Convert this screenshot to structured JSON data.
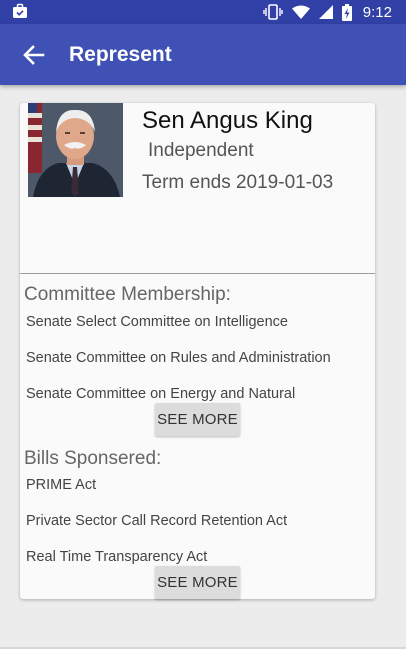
{
  "status_bar": {
    "time": "9:12",
    "icons": [
      "briefcase-icon",
      "vibrate-icon",
      "wifi-icon",
      "signal-icon",
      "battery-charging-icon"
    ]
  },
  "app_bar": {
    "title": "Represent",
    "back_icon": "arrow-back-icon"
  },
  "representative": {
    "name": "Sen Angus King",
    "party": "Independent",
    "term": "Term ends 2019-01-03"
  },
  "committees": {
    "title": "Committee Membership:",
    "items": [
      "Senate Select Committee on Intelligence",
      "Senate Committee on Rules and Administration",
      "Senate Committee on Energy and Natural"
    ],
    "button_label": "SEE MORE"
  },
  "bills": {
    "title": "Bills Sponsered:",
    "items": [
      "PRIME Act",
      "Private Sector Call Record Retention Act",
      "Real Time Transparency Act"
    ],
    "button_label": "SEE MORE"
  },
  "colors": {
    "status_bar": "#3140a6",
    "app_bar": "#3f51b5",
    "card": "#fafafa",
    "background": "#ececec"
  }
}
